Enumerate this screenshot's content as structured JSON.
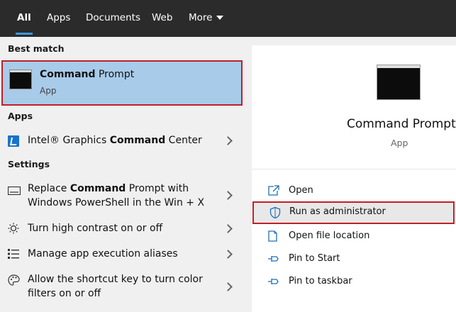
{
  "tabs": [
    {
      "label": "All",
      "active": true
    },
    {
      "label": "Apps"
    },
    {
      "label": "Documents"
    },
    {
      "label": "Web"
    },
    {
      "label": "More"
    }
  ],
  "left": {
    "best_match_header": "Best match",
    "best_match": {
      "title_bold": "Command",
      "title_rest": " Prompt",
      "subtitle": "App"
    },
    "apps_header": "Apps",
    "apps": [
      {
        "pre": "Intel® Graphics ",
        "bold": "Command",
        "post": " Center"
      }
    ],
    "settings_header": "Settings",
    "settings": [
      {
        "pre": "Replace ",
        "bold": "Command",
        "post": " Prompt with",
        "line2": "Windows PowerShell in the Win + X"
      },
      {
        "text": "Turn high contrast on or off"
      },
      {
        "text": "Manage app execution aliases"
      },
      {
        "text": "Allow the shortcut key to turn color",
        "line2": "filters on or off"
      }
    ]
  },
  "right": {
    "title": "Command Prompt",
    "subtitle": "App",
    "actions": [
      {
        "label": "Open",
        "icon": "open-icon"
      },
      {
        "label": "Run as administrator",
        "icon": "shield-icon"
      },
      {
        "label": "Open file location",
        "icon": "file-location-icon"
      },
      {
        "label": "Pin to Start",
        "icon": "pin-icon"
      },
      {
        "label": "Pin to taskbar",
        "icon": "pin-icon"
      }
    ]
  },
  "colors": {
    "accent": "#3f94d9",
    "highlight": "#a8cbe9",
    "outline": "#c21f26",
    "topbar": "#2b2b2b"
  }
}
